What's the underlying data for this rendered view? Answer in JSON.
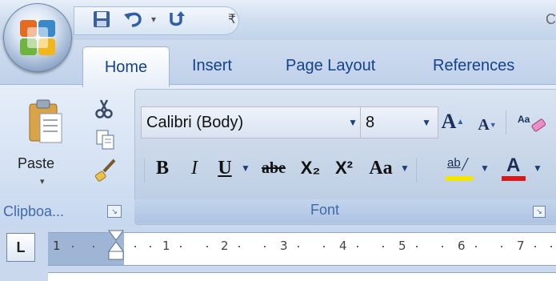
{
  "title_fragment": "C",
  "tabs": {
    "home": "Home",
    "insert": "Insert",
    "page_layout": "Page Layout",
    "references": "References"
  },
  "clipboard": {
    "paste_label": "Paste",
    "group_title": "Clipboa..."
  },
  "font": {
    "font_name": "Calibri (Body)",
    "font_size": "8",
    "group_title": "Font",
    "bold": "B",
    "italic": "I",
    "underline": "U",
    "strikethrough": "abe",
    "subscript": "X₂",
    "superscript": "X²",
    "change_case": "Aa",
    "grow": "A",
    "shrink": "A",
    "highlight": "ab",
    "font_color": "A"
  },
  "ruler": {
    "tab_selector": "L",
    "numbers": [
      "1",
      "2",
      "3",
      "4",
      "5",
      "6",
      "7"
    ]
  },
  "colors": {
    "accent": "#15428b",
    "highlight_yellow": "#f2e600",
    "font_red": "#d41a1a"
  }
}
